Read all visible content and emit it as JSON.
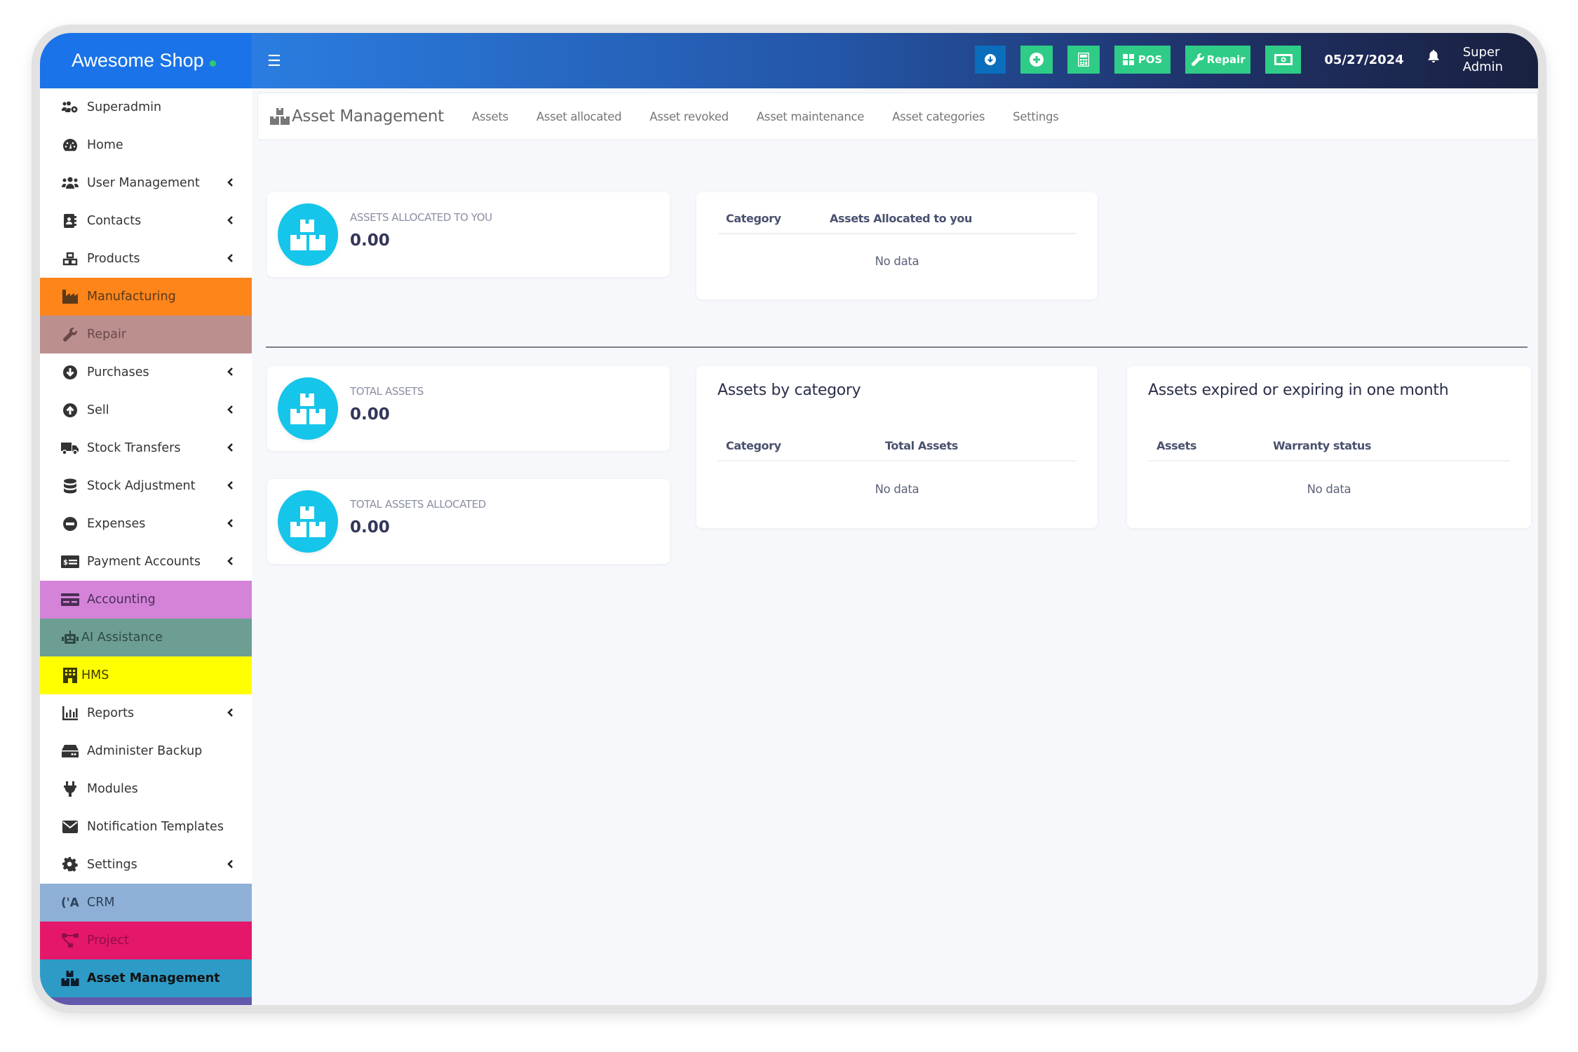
{
  "brand": {
    "name": "Awesome Shop",
    "status_dot_color": "#2ecc71"
  },
  "header": {
    "menu_icon": "hamburger-icon",
    "buttons": [
      {
        "name": "download",
        "icon": "arrow-circle-down-icon",
        "label": ""
      },
      {
        "name": "add",
        "icon": "plus-circle-icon",
        "label": ""
      },
      {
        "name": "calculator",
        "icon": "calculator-icon",
        "label": ""
      },
      {
        "name": "pos",
        "icon": "th-large-icon",
        "label": "POS"
      },
      {
        "name": "repair",
        "icon": "wrench-icon",
        "label": "Repair"
      },
      {
        "name": "cash",
        "icon": "money-bill-icon",
        "label": ""
      }
    ],
    "date": "05/27/2024",
    "notification_icon": "bell-icon",
    "user": "Super Admin"
  },
  "sidebar": {
    "items": [
      {
        "label": "Superadmin",
        "icon": "users-cog-icon",
        "submenu": false,
        "bg": ""
      },
      {
        "label": "Home",
        "icon": "tachometer-icon",
        "submenu": false,
        "bg": ""
      },
      {
        "label": "User Management",
        "icon": "users-icon",
        "submenu": true,
        "bg": ""
      },
      {
        "label": "Contacts",
        "icon": "address-book-icon",
        "submenu": true,
        "bg": ""
      },
      {
        "label": "Products",
        "icon": "cubes-icon",
        "submenu": true,
        "bg": ""
      },
      {
        "label": "Manufacturing",
        "icon": "industry-icon",
        "submenu": false,
        "bg": "#fd851a"
      },
      {
        "label": "Repair",
        "icon": "wrench-icon",
        "submenu": false,
        "bg": "#bc8f8f"
      },
      {
        "label": "Purchases",
        "icon": "arrow-circle-down-icon",
        "submenu": true,
        "bg": ""
      },
      {
        "label": "Sell",
        "icon": "arrow-circle-up-icon",
        "submenu": true,
        "bg": ""
      },
      {
        "label": "Stock Transfers",
        "icon": "truck-icon",
        "submenu": true,
        "bg": ""
      },
      {
        "label": "Stock Adjustment",
        "icon": "database-icon",
        "submenu": true,
        "bg": ""
      },
      {
        "label": "Expenses",
        "icon": "minus-circle-icon",
        "submenu": true,
        "bg": ""
      },
      {
        "label": "Payment Accounts",
        "icon": "money-check-icon",
        "submenu": true,
        "bg": ""
      },
      {
        "label": "Accounting",
        "icon": "credit-card-icon",
        "submenu": false,
        "bg": "#d483d9"
      },
      {
        "label": "AI Assistance",
        "icon": "robot-icon",
        "submenu": false,
        "bg": "#6d9e93"
      },
      {
        "label": "HMS",
        "icon": "hotel-icon",
        "submenu": false,
        "bg": "#ffff00"
      },
      {
        "label": "Reports",
        "icon": "chart-bar-icon",
        "submenu": true,
        "bg": ""
      },
      {
        "label": "Administer Backup",
        "icon": "hdd-icon",
        "submenu": false,
        "bg": ""
      },
      {
        "label": "Modules",
        "icon": "plug-icon",
        "submenu": false,
        "bg": ""
      },
      {
        "label": "Notification Templates",
        "icon": "envelope-icon",
        "submenu": false,
        "bg": ""
      },
      {
        "label": "Settings",
        "icon": "cog-icon",
        "submenu": true,
        "bg": ""
      },
      {
        "label": "CRM",
        "icon": "broadcast-tower-icon",
        "submenu": false,
        "bg": "#8eb0d6"
      },
      {
        "label": "Project",
        "icon": "project-diagram-icon",
        "submenu": false,
        "bg": "#e5176a"
      },
      {
        "label": "Asset Management",
        "icon": "boxes-icon",
        "submenu": false,
        "bg": "#2e9bc6",
        "active": true
      },
      {
        "label": "",
        "icon": "",
        "submenu": false,
        "bg": "#6258ac"
      }
    ]
  },
  "tabbar": {
    "title": "Asset Management",
    "tabs": [
      "Assets",
      "Asset allocated",
      "Asset revoked",
      "Asset maintenance",
      "Asset categories",
      "Settings"
    ]
  },
  "stats": [
    {
      "title": "ASSETS ALLOCATED TO YOU",
      "value": "0.00"
    },
    {
      "title": "TOTAL ASSETS",
      "value": "0.00"
    },
    {
      "title": "TOTAL ASSETS ALLOCATED",
      "value": "0.00"
    }
  ],
  "tables": {
    "allocated_to_you": {
      "title": "",
      "columns": [
        "Category",
        "Assets Allocated to you"
      ],
      "empty_text": "No data"
    },
    "by_category": {
      "title": "Assets by category",
      "columns": [
        "Category",
        "Total Assets"
      ],
      "empty_text": "No data"
    },
    "expiring": {
      "title": "Assets expired or expiring in one month",
      "columns": [
        "Assets",
        "Warranty status"
      ],
      "empty_text": "No data"
    }
  },
  "colors": {
    "accent_icon": "#15c5ea",
    "header_button_green": "#2ecc86",
    "header_button_blue": "#0a6ebd"
  }
}
